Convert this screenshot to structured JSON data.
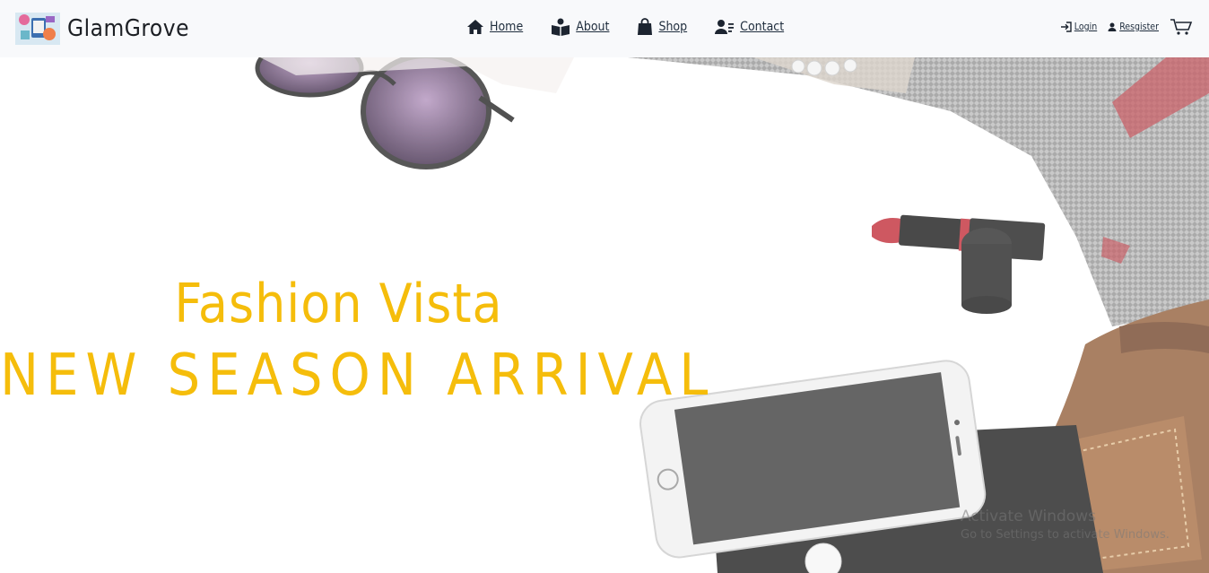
{
  "brand": {
    "name": "GlamGrove",
    "logo_icon": "shopping-logo-icon"
  },
  "nav": {
    "items": [
      {
        "label": "Home",
        "icon": "home-icon"
      },
      {
        "label": "About",
        "icon": "book-reader-icon"
      },
      {
        "label": "Shop",
        "icon": "shopping-bag-icon"
      },
      {
        "label": "Contact",
        "icon": "contact-icon"
      }
    ]
  },
  "auth": {
    "login": {
      "label": "Login",
      "icon": "login-icon"
    },
    "register": {
      "label": "Resgister",
      "icon": "user-icon"
    },
    "cart_icon": "cart-icon"
  },
  "hero": {
    "title": "Fashion Vista",
    "subtitle": "NEW SEASON ARRIVAL",
    "accent_color": "#f5bd0b"
  },
  "watermark": {
    "line1": "Activate Windows",
    "line2": "Go to Settings to activate Windows."
  }
}
